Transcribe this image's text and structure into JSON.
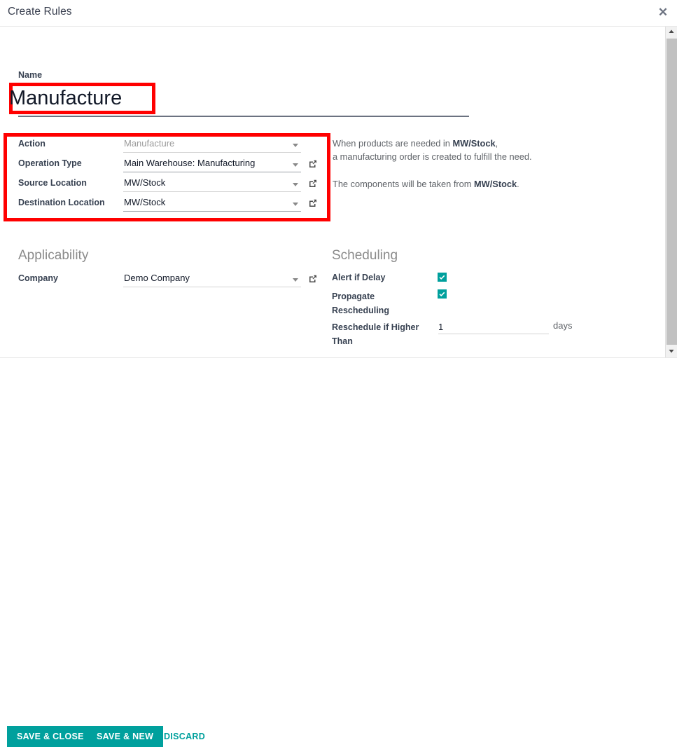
{
  "dialog": {
    "title": "Create Rules",
    "close_icon": "close-icon"
  },
  "name_field": {
    "label": "Name",
    "value": "Manufacture",
    "placeholder": "e.g. Buy"
  },
  "rule_fields": [
    {
      "label": "Action",
      "value": "Manufacture",
      "muted": true,
      "has_external_link": false
    },
    {
      "label": "Operation Type",
      "value": "Main Warehouse: Manufacturing",
      "muted": false,
      "has_external_link": true
    },
    {
      "label": "Source Location",
      "value": "MW/Stock",
      "muted": false,
      "has_external_link": true
    },
    {
      "label": "Destination Location",
      "value": "MW/Stock",
      "muted": false,
      "has_external_link": true
    }
  ],
  "description": {
    "line1_pre": "When products are needed in ",
    "line1_bold": "MW/Stock",
    "line1_post": ",",
    "line2": "a manufacturing order is created to fulfill the need.",
    "line3_pre": "The components will be taken from ",
    "line3_bold": "MW/Stock",
    "line3_post": "."
  },
  "applicability": {
    "title": "Applicability",
    "company_label": "Company",
    "company_value": "Demo Company"
  },
  "scheduling": {
    "title": "Scheduling",
    "alert_if_delay_label": "Alert if Delay",
    "alert_if_delay_checked": true,
    "propagate_rescheduling_label": "Propagate Rescheduling",
    "propagate_rescheduling_checked": true,
    "reschedule_if_higher_label": "Reschedule if Higher Than",
    "reschedule_if_higher_value": "1",
    "reschedule_units": "days"
  },
  "footer": {
    "save_close_label": "SAVE & CLOSE",
    "save_new_label": "SAVE & NEW",
    "discard_label": "DISCARD"
  },
  "colors": {
    "accent": "#00a09d",
    "highlight": "#ff0000"
  }
}
